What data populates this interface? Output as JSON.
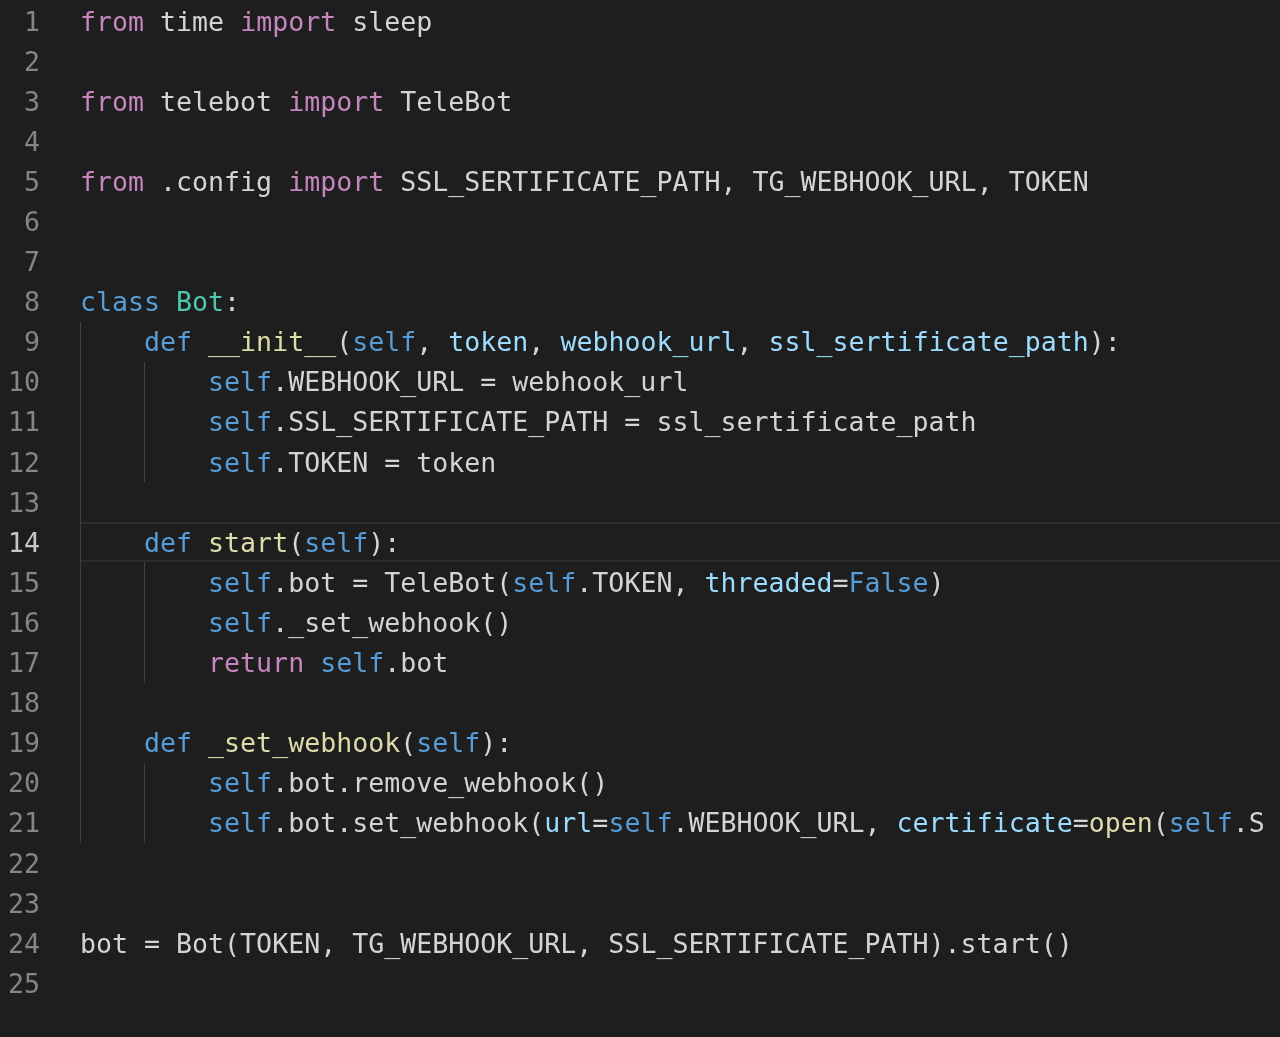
{
  "editor": {
    "lines": [
      {
        "number": "1",
        "current": false,
        "tokens": [
          {
            "text": "from",
            "kind": "keyword"
          },
          {
            "text": " time ",
            "kind": "plain"
          },
          {
            "text": "import",
            "kind": "keyword"
          },
          {
            "text": " sleep",
            "kind": "plain"
          }
        ]
      },
      {
        "number": "2",
        "current": false
      },
      {
        "number": "3",
        "current": false,
        "tokens": [
          {
            "text": "from",
            "kind": "keyword"
          },
          {
            "text": " telebot ",
            "kind": "plain"
          },
          {
            "text": "import",
            "kind": "keyword"
          },
          {
            "text": " TeleBot",
            "kind": "plain"
          }
        ]
      },
      {
        "number": "4",
        "current": false
      },
      {
        "number": "5",
        "current": false,
        "tokens": [
          {
            "text": "from",
            "kind": "keyword"
          },
          {
            "text": " .config ",
            "kind": "plain"
          },
          {
            "text": "import",
            "kind": "keyword"
          },
          {
            "text": " SSL_SERTIFICATE_PATH, TG_WEBHOOK_URL, TOKEN",
            "kind": "plain"
          }
        ]
      },
      {
        "number": "6",
        "current": false
      },
      {
        "number": "7",
        "current": false
      },
      {
        "number": "8",
        "current": false,
        "tokens": [
          {
            "text": "class",
            "kind": "storage"
          },
          {
            "text": " Bot",
            "kind": "class"
          },
          {
            "text": ":",
            "kind": "plain"
          }
        ],
        "children": [
          {
            "number": "9",
            "current": false,
            "tokens": [
              {
                "text": "def",
                "kind": "storage"
              },
              {
                "text": " __init__",
                "kind": "function"
              },
              {
                "text": "(",
                "kind": "plain"
              },
              {
                "text": "self",
                "kind": "storage"
              },
              {
                "text": ", ",
                "kind": "plain"
              },
              {
                "text": "token",
                "kind": "param"
              },
              {
                "text": ", ",
                "kind": "plain"
              },
              {
                "text": "webhook_url",
                "kind": "param"
              },
              {
                "text": ", ",
                "kind": "plain"
              },
              {
                "text": "ssl_sertificate_path",
                "kind": "param"
              },
              {
                "text": "):",
                "kind": "plain"
              }
            ],
            "children": [
              {
                "number": "10",
                "current": false,
                "tokens": [
                  {
                    "text": "self",
                    "kind": "storage"
                  },
                  {
                    "text": ".WEBHOOK_URL = webhook_url",
                    "kind": "plain"
                  }
                ]
              },
              {
                "number": "11",
                "current": false,
                "tokens": [
                  {
                    "text": "self",
                    "kind": "storage"
                  },
                  {
                    "text": ".SSL_SERTIFICATE_PATH = ssl_sertificate_path",
                    "kind": "plain"
                  }
                ]
              },
              {
                "number": "12",
                "current": false,
                "tokens": [
                  {
                    "text": "self",
                    "kind": "storage"
                  },
                  {
                    "text": ".TOKEN = token",
                    "kind": "plain"
                  }
                ]
              }
            ]
          },
          {
            "number": "13",
            "current": false
          },
          {
            "number": "14",
            "current": true,
            "tokens": [
              {
                "text": "def",
                "kind": "storage"
              },
              {
                "text": " start",
                "kind": "function"
              },
              {
                "text": "(",
                "kind": "plain"
              },
              {
                "text": "self",
                "kind": "storage"
              },
              {
                "text": "):",
                "kind": "plain"
              }
            ],
            "children": [
              {
                "number": "15",
                "current": false,
                "tokens": [
                  {
                    "text": "self",
                    "kind": "storage"
                  },
                  {
                    "text": ".bot = TeleBot(",
                    "kind": "plain"
                  },
                  {
                    "text": "self",
                    "kind": "storage"
                  },
                  {
                    "text": ".TOKEN, ",
                    "kind": "plain"
                  },
                  {
                    "text": "threaded",
                    "kind": "param"
                  },
                  {
                    "text": "=",
                    "kind": "plain"
                  },
                  {
                    "text": "False",
                    "kind": "storage"
                  },
                  {
                    "text": ")",
                    "kind": "plain"
                  }
                ]
              },
              {
                "number": "16",
                "current": false,
                "tokens": [
                  {
                    "text": "self",
                    "kind": "storage"
                  },
                  {
                    "text": "._set_webhook()",
                    "kind": "plain"
                  }
                ]
              },
              {
                "number": "17",
                "current": false,
                "tokens": [
                  {
                    "text": "return",
                    "kind": "keyword"
                  },
                  {
                    "text": " self",
                    "kind": "storage"
                  },
                  {
                    "text": ".bot",
                    "kind": "plain"
                  }
                ]
              }
            ]
          },
          {
            "number": "18",
            "current": false
          },
          {
            "number": "19",
            "current": false,
            "tokens": [
              {
                "text": "def",
                "kind": "storage"
              },
              {
                "text": " _set_webhook",
                "kind": "function"
              },
              {
                "text": "(",
                "kind": "plain"
              },
              {
                "text": "self",
                "kind": "storage"
              },
              {
                "text": "):",
                "kind": "plain"
              }
            ],
            "children": [
              {
                "number": "20",
                "current": false,
                "tokens": [
                  {
                    "text": "self",
                    "kind": "storage"
                  },
                  {
                    "text": ".bot.remove_webhook()",
                    "kind": "plain"
                  }
                ]
              },
              {
                "number": "21",
                "current": false,
                "tokens": [
                  {
                    "text": "self",
                    "kind": "storage"
                  },
                  {
                    "text": ".bot.set_webhook(",
                    "kind": "plain"
                  },
                  {
                    "text": "url",
                    "kind": "param"
                  },
                  {
                    "text": "=",
                    "kind": "plain"
                  },
                  {
                    "text": "self",
                    "kind": "storage"
                  },
                  {
                    "text": ".WEBHOOK_URL, ",
                    "kind": "plain"
                  },
                  {
                    "text": "certificate",
                    "kind": "param"
                  },
                  {
                    "text": "=",
                    "kind": "plain"
                  },
                  {
                    "text": "open",
                    "kind": "function"
                  },
                  {
                    "text": "(",
                    "kind": "plain"
                  },
                  {
                    "text": "self",
                    "kind": "storage"
                  },
                  {
                    "text": ".S",
                    "kind": "plain"
                  }
                ]
              }
            ]
          }
        ]
      },
      {
        "number": "22",
        "current": false
      },
      {
        "number": "23",
        "current": false
      },
      {
        "number": "24",
        "current": false,
        "tokens": [
          {
            "text": "bot = Bot(TOKEN, TG_WEBHOOK_URL, SSL_SERTIFICATE_PATH).start()",
            "kind": "plain"
          }
        ]
      },
      {
        "number": "25",
        "current": false
      }
    ]
  }
}
